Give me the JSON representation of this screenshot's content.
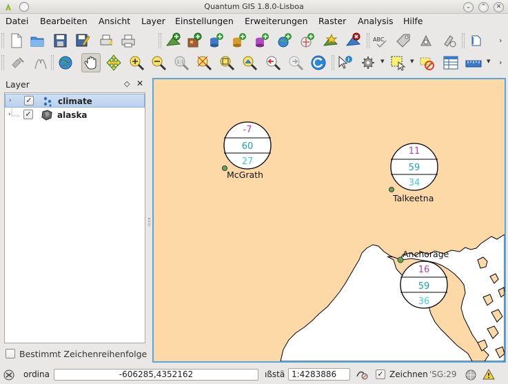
{
  "window": {
    "title": "Quantum GIS 1.8.0-Lisboa"
  },
  "menubar": {
    "items": [
      "Datei",
      "Bearbeiten",
      "Ansicht",
      "Layer",
      "Einstellungen",
      "Erweiterungen",
      "Raster",
      "Analysis",
      "Hilfe"
    ]
  },
  "toolbar1": {
    "icons": [
      "new-project-icon",
      "open-project-icon",
      "save-project-icon",
      "save-as-icon",
      "new-print-composer-icon",
      "print-icon",
      "add-vector-layer-icon",
      "add-raster-layer-icon",
      "add-postgis-layer-icon",
      "add-spatialite-layer-icon",
      "add-mssql-layer-icon",
      "add-wms-layer-icon",
      "add-wfs-layer-icon",
      "new-shapefile-icon",
      "remove-layer-icon",
      "spell-check-icon",
      "label-tool-icon",
      "plugin-manager-icon",
      "python-console-icon"
    ]
  },
  "toolbar2": {
    "icons": [
      "digitize-icon",
      "node-tool-icon",
      "globe-icon",
      "pan-icon",
      "pan-to-selection-icon",
      "zoom-in-icon",
      "zoom-out-icon",
      "zoom-actual-icon",
      "zoom-to-selection-icon",
      "zoom-full-icon",
      "zoom-to-layer-icon",
      "zoom-last-icon",
      "zoom-next-icon",
      "refresh-icon",
      "identify-icon",
      "action-icon",
      "select-icon",
      "deselect-icon",
      "attribute-table-icon",
      "measure-icon"
    ]
  },
  "layers_panel": {
    "title": "Layer",
    "layers": [
      {
        "name": "climate",
        "checked": true,
        "selected": true,
        "icon": "point-layer-icon"
      },
      {
        "name": "alaska",
        "checked": true,
        "selected": false,
        "icon": "polygon-layer-icon"
      }
    ],
    "draw_order_label": "Bestimmt Zeichenreihenfolge",
    "draw_order_checked": false
  },
  "map": {
    "background_color": "#fdd9a8",
    "water_color": "#ffffff",
    "diagrams": [
      {
        "place": "McGrath",
        "values": [
          "-7",
          "60",
          "27"
        ]
      },
      {
        "place": "Talkeetna",
        "values": [
          "11",
          "59",
          "34"
        ]
      },
      {
        "place": "Anchorage",
        "values": [
          "16",
          "59",
          "36"
        ]
      }
    ],
    "value_colors": [
      "#b040c0",
      "#1aa0c0",
      "#40d0d8"
    ],
    "point_color": "#6aa843"
  },
  "statusbar": {
    "coordinate_label": "ordina",
    "coordinate_value": "-606285,4352162",
    "scale_label": "ıßstä",
    "scale_value": "1:4283886",
    "render_label": "Zeichnen",
    "render_checked": true,
    "crs_label": "'SG:29"
  }
}
